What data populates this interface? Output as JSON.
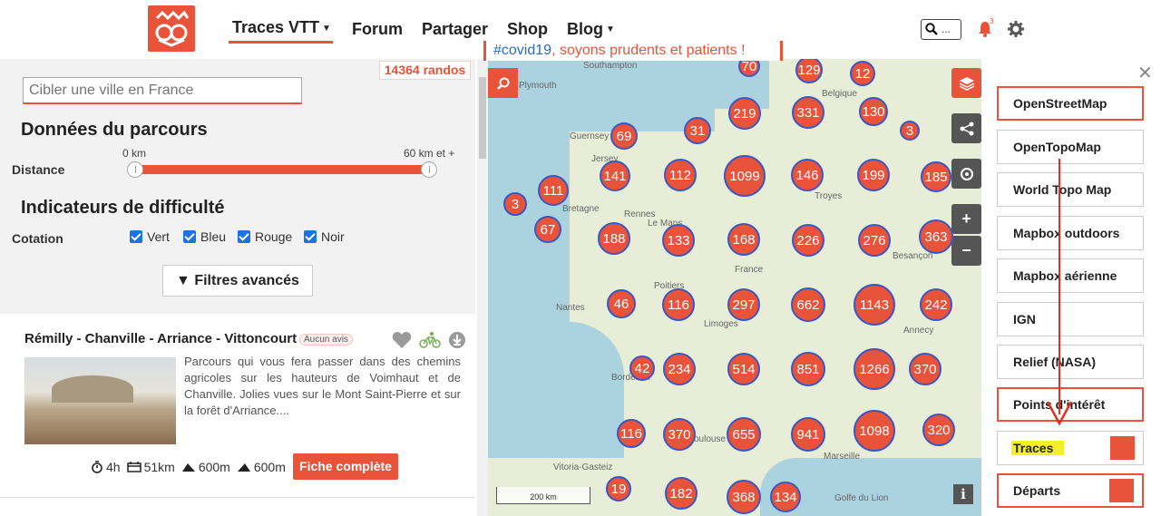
{
  "nav": {
    "items": [
      "Traces VTT",
      "Forum",
      "Partager",
      "Shop",
      "Blog"
    ],
    "search_placeholder": "...",
    "notif_count": "3"
  },
  "banner": {
    "hashtag": "#covid19",
    "text": ", soyons prudents et patients !"
  },
  "filters": {
    "count": "14364 randos",
    "city_placeholder": "Cibler une ville en France",
    "section_route": "Données du parcours",
    "distance_label": "Distance",
    "range_min": "0 km",
    "range_max": "60 km et +",
    "section_difficulty": "Indicateurs de difficulté",
    "cotation_label": "Cotation",
    "checks": [
      "Vert",
      "Bleu",
      "Rouge",
      "Noir"
    ],
    "advanced_btn": "▼ Filtres avancés"
  },
  "card": {
    "title": "Rémilly - Chanville - Arriance - Vittoncourt",
    "review": "Aucun avis",
    "description": "Parcours qui vous fera passer dans des chemins agricoles sur les hauteurs de Voimhaut et de Chanville. Jolies vues sur le Mont Saint-Pierre et sur la forêt d'Arriance....",
    "duration": "4h",
    "distance": "51km",
    "ascent": "600m",
    "descent": "600m",
    "cta": "Fiche complète"
  },
  "map": {
    "scale": "200 km",
    "info": "i",
    "clusters": [
      "70",
      "129",
      "12",
      "219",
      "331",
      "130",
      "3",
      "69",
      "31",
      "141",
      "112",
      "1099",
      "146",
      "199",
      "185",
      "3",
      "111",
      "67",
      "188",
      "133",
      "168",
      "226",
      "276",
      "363",
      "46",
      "116",
      "297",
      "662",
      "1143",
      "242",
      "42",
      "234",
      "514",
      "851",
      "1266",
      "370",
      "116",
      "370",
      "655",
      "941",
      "1098",
      "320",
      "19",
      "182",
      "368",
      "134"
    ],
    "labels": [
      "Southampton",
      "Plymouth",
      "Guernsey",
      "Jersey",
      "Rennes",
      "Le Mans",
      "Troyes",
      "France",
      "Poitiers",
      "Limoges",
      "Nantes",
      "Bretagne",
      "Belgique",
      "Besançon",
      "Annecy",
      "Marseille",
      "Golfe du Lion",
      "Vitoria-Gasteiz",
      "Toulouse",
      "Bordeaux"
    ]
  },
  "layers": [
    "OpenStreetMap",
    "OpenTopoMap",
    "World Topo Map",
    "Mapbox outdoors",
    "Mapbox aérienne",
    "IGN",
    "Relief (NASA)",
    "Points d'intérêt",
    "Traces",
    "Départs"
  ]
}
